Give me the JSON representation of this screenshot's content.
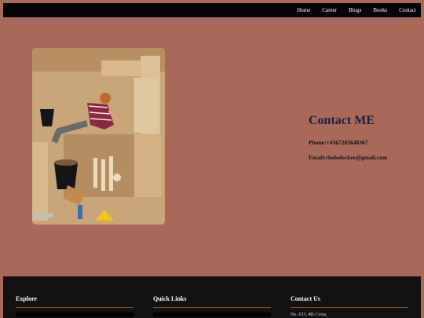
{
  "nav": {
    "items": [
      "Home",
      "Career",
      "Blogs",
      "Books",
      "Contact"
    ]
  },
  "contact": {
    "title": "Contact ME",
    "phone": "Phone:+4567283648367",
    "email": "Email:choledecker@gmail.com"
  },
  "footer": {
    "explore_heading": "Explore",
    "quick_links_heading": "Quick Links",
    "contact_heading": "Contact Us",
    "address_line": "No. 633, 4th Cross,"
  },
  "colors": {
    "page_background": "#a8695a",
    "navbar": "#050505",
    "footer": "#121212",
    "accent_rule": "#8a5a34"
  },
  "images": {
    "photo": "archaeologist-excavating-skeleton"
  }
}
